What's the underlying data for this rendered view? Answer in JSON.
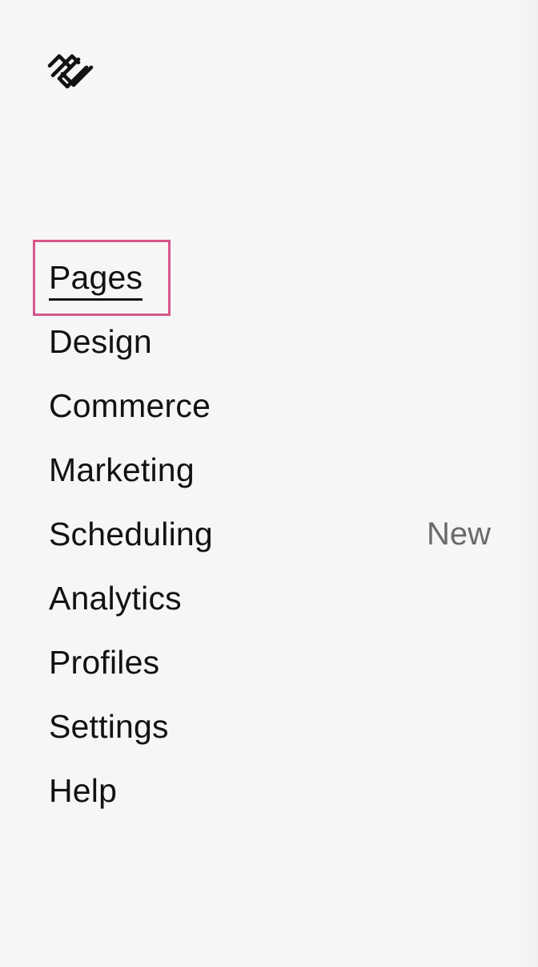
{
  "logo": {
    "icon": "squarespace-logo-icon"
  },
  "nav": {
    "items": [
      {
        "label": "Pages",
        "active": true
      },
      {
        "label": "Design"
      },
      {
        "label": "Commerce"
      },
      {
        "label": "Marketing"
      },
      {
        "label": "Scheduling",
        "badge": "New"
      },
      {
        "label": "Analytics"
      },
      {
        "label": "Profiles"
      },
      {
        "label": "Settings"
      },
      {
        "label": "Help"
      }
    ]
  },
  "colors": {
    "background": "#f6f6f6",
    "text": "#121212",
    "focus_outline": "#d6568a",
    "badge_text": "#6a6a6a"
  }
}
